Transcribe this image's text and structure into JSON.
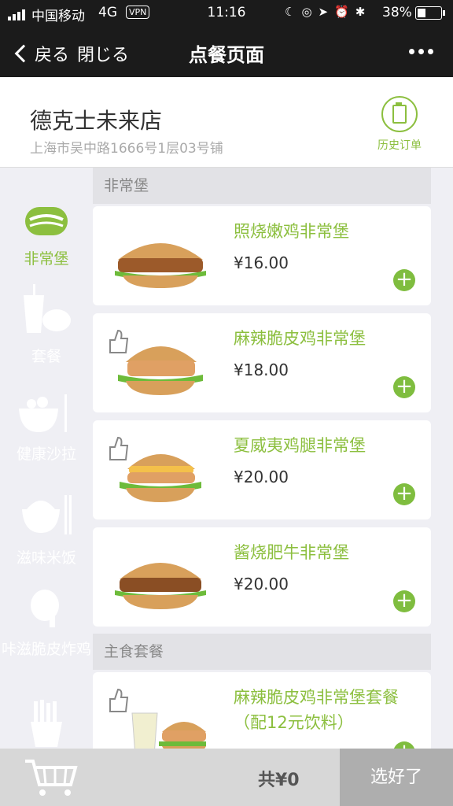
{
  "status": {
    "carrier": "中国移动",
    "network": "4G",
    "vpn": "VPN",
    "time": "11:16",
    "battery": "38%"
  },
  "nav": {
    "back": "戻る",
    "close": "閉じる",
    "title": "点餐页面"
  },
  "store": {
    "name": "德克士未来店",
    "address": "上海市吴中路1666号1层03号铺",
    "history": "历史订单"
  },
  "categories": [
    {
      "label": "非常堡",
      "icon": "burger-icon"
    },
    {
      "label": "套餐",
      "icon": "combo-icon"
    },
    {
      "label": "健康沙拉",
      "icon": "salad-icon"
    },
    {
      "label": "滋味米饭",
      "icon": "rice-icon"
    },
    {
      "label": "咔滋脆皮炸鸡",
      "icon": "drumstick-icon"
    },
    {
      "label": "",
      "icon": "fries-icon"
    }
  ],
  "sections": [
    {
      "title": "非常堡",
      "items": [
        {
          "name": "照烧嫩鸡非常堡",
          "price": "¥16.00"
        },
        {
          "name": "麻辣脆皮鸡非常堡",
          "price": "¥18.00"
        },
        {
          "name": "夏威夷鸡腿非常堡",
          "price": "¥20.00"
        },
        {
          "name": "酱烧肥牛非常堡",
          "price": "¥20.00"
        }
      ]
    },
    {
      "title": "主食套餐",
      "items": [
        {
          "name": "麻辣脆皮鸡非常堡套餐（配12元饮料）",
          "price": ""
        }
      ]
    }
  ],
  "cart": {
    "total": "共¥0",
    "done": "选好了"
  },
  "colors": {
    "accent": "#8cbf3f",
    "header": "#1b1b1b"
  }
}
